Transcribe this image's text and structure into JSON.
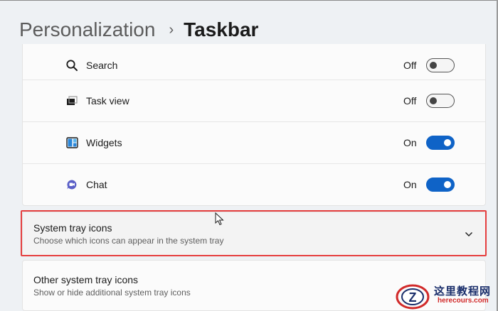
{
  "breadcrumb": {
    "parent": "Personalization",
    "separator": "›",
    "current": "Taskbar"
  },
  "taskbar_items": [
    {
      "label": "Search",
      "state": "Off",
      "icon": "search-icon"
    },
    {
      "label": "Task view",
      "state": "Off",
      "icon": "task-view-icon"
    },
    {
      "label": "Widgets",
      "state": "On",
      "icon": "widgets-icon"
    },
    {
      "label": "Chat",
      "state": "On",
      "icon": "chat-icon"
    }
  ],
  "system_tray": {
    "title": "System tray icons",
    "subtitle": "Choose which icons can appear in the system tray",
    "icon": "chevron-down-icon"
  },
  "other_tray": {
    "title": "Other system tray icons",
    "subtitle": "Show or hide additional system tray icons"
  },
  "watermark": {
    "text": "这里教程网",
    "sub": "herecours.com",
    "logo_letter": "Z"
  },
  "colors": {
    "accent": "#0f63c7",
    "highlight": "#e53e3e",
    "background": "#eef1f4"
  }
}
